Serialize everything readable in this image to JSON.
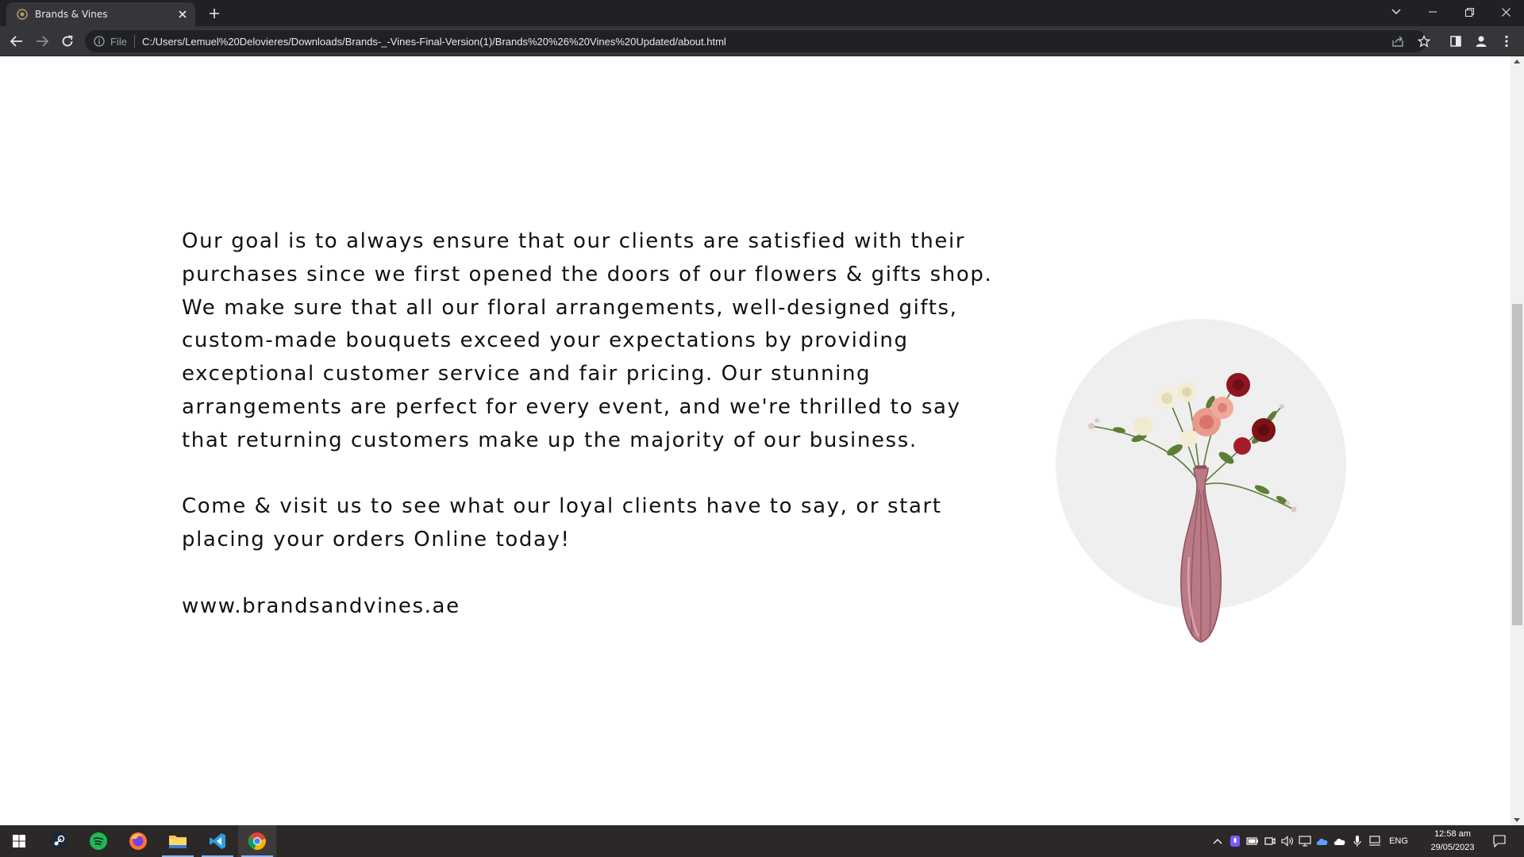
{
  "browser": {
    "tab_title": "Brands & Vines",
    "url_scheme": "File",
    "url": "C:/Users/Lemuel%20Delovieres/Downloads/Brands-_-Vines-Final-Version(1)/Brands%20%26%20Vines%20Updated/about.html"
  },
  "page": {
    "paragraph_1": "Our goal is to always ensure that our clients are satisfied with their purchases since we first opened the doors of our flowers & gifts shop. We make sure that all our floral arrangements, well-designed gifts, custom-made bouquets exceed your expectations by providing exceptional customer service and fair pricing. Our stunning arrangements are perfect for every event, and we're thrilled to say that returning customers make up the majority of our business.",
    "paragraph_2": "Come & visit us to see what our loyal clients have to say, or start placing your orders Online today!",
    "website": "www.brandsandvines.ae"
  },
  "taskbar": {
    "language": "ENG",
    "time": "12:58 am",
    "date": "29/05/2023"
  },
  "colors": {
    "page_background": "#ffffff",
    "text": "#111111",
    "vase_circle": "#efefef",
    "vase_glass": "#b97a86",
    "chrome_dark": "#202124",
    "chrome_toolbar": "#35363a",
    "taskbar": "#2b2827"
  }
}
